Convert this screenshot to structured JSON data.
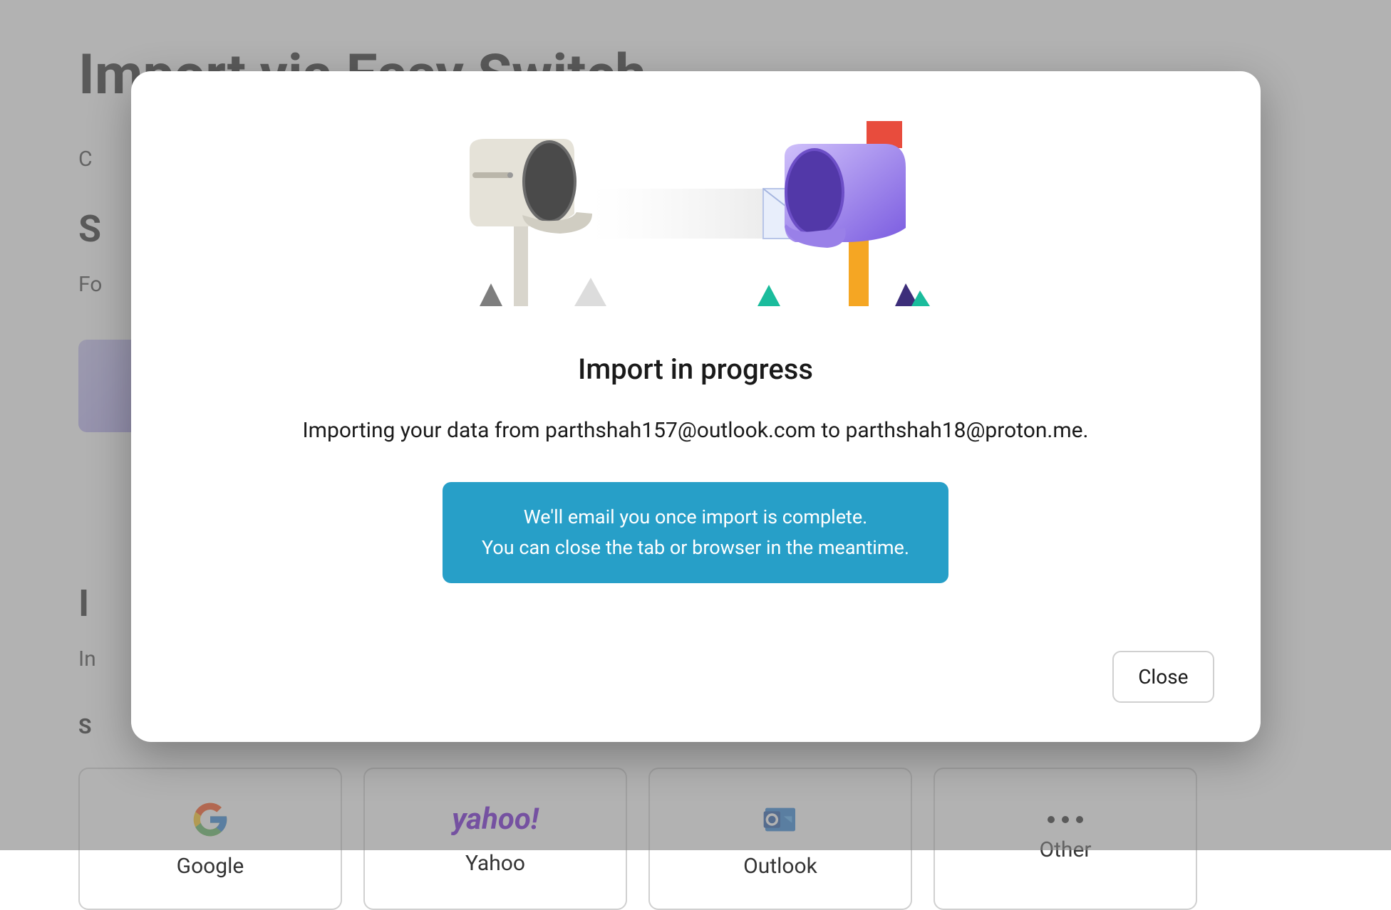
{
  "background": {
    "title": "Import via Easy Switch",
    "intro_letter": "C",
    "section_title_letter": "S",
    "section_subtitle_prefix": "Fo",
    "section_title_letter_2": "I",
    "section_subtitle_2": "In",
    "section_title_letter_3": "S",
    "services": [
      {
        "name": "Google",
        "icon": "google-icon"
      },
      {
        "name": "Yahoo",
        "icon": "yahoo-icon"
      },
      {
        "name": "Outlook",
        "icon": "outlook-icon"
      },
      {
        "name": "Other",
        "icon": "dots-icon"
      }
    ]
  },
  "modal": {
    "title": "Import in progress",
    "subtitle": "Importing your data from parthshah157@outlook.com to parthshah18@proton.me.",
    "info_line_1": "We'll email you once import is complete.",
    "info_line_2": "You can close the tab or browser in the meantime.",
    "close_label": "Close"
  }
}
